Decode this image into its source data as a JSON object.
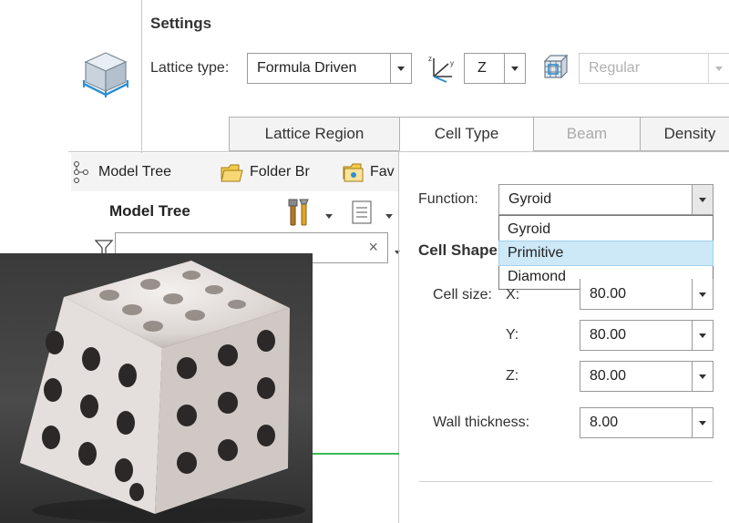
{
  "ribbon": {
    "settings_title": "Settings",
    "lattice_type_label": "Lattice type:",
    "lattice_type_value": "Formula Driven",
    "axis_value": "Z",
    "pattern_value": "Regular"
  },
  "tabs": [
    {
      "label": "Lattice Region"
    },
    {
      "label": "Cell Type"
    },
    {
      "label": "Beam"
    },
    {
      "label": "Density"
    }
  ],
  "model_tree": {
    "tab_model_tree": "Model Tree",
    "tab_folder_browser": "Folder Br",
    "tab_favorites": "Fav",
    "heading": "Model Tree",
    "filter_clear": "×"
  },
  "form": {
    "function_label": "Function:",
    "function_value": "Gyroid",
    "function_options": [
      "Gyroid",
      "Primitive",
      "Diamond"
    ],
    "cell_shape_label": "Cell Shape",
    "cell_size_label": "Cell size:",
    "x_label": "X:",
    "x_value": "80.00",
    "y_label": "Y:",
    "y_value": "80.00",
    "z_label": "Z:",
    "z_value": "80.00",
    "wall_thickness_label": "Wall thickness:",
    "wall_thickness_value": "8.00"
  },
  "colors": {
    "selection_highlight": "#cde8f6",
    "accent_green": "#3cb95a"
  }
}
